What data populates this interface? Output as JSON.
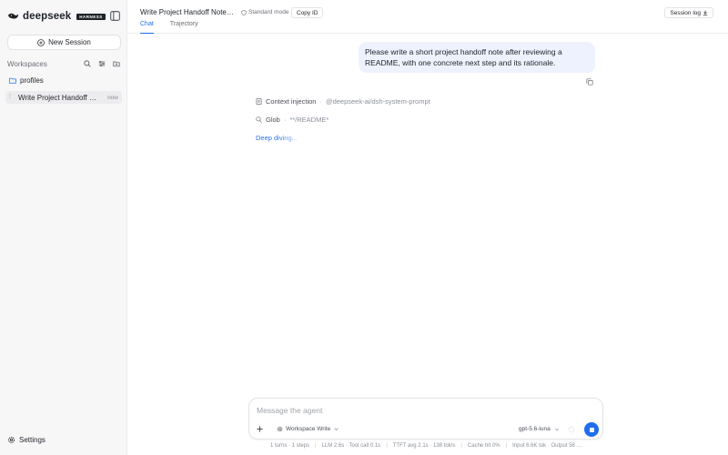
{
  "brand": {
    "name": "deepseek",
    "badge": "HARNESS"
  },
  "sidebar": {
    "new_session_label": "New Session",
    "workspaces_label": "Workspaces",
    "folder_label": "profiles",
    "session": {
      "title": "Write Project Handoff Note with",
      "time": "now",
      "status_glyph": "⁞"
    },
    "settings_label": "Settings"
  },
  "header": {
    "title": "Write Project Handoff Note with…",
    "mode_label": "Standard mode",
    "copy_id_label": "Copy ID",
    "session_log_label": "Session log",
    "tabs": [
      {
        "label": "Chat",
        "active": true
      },
      {
        "label": "Trajectory",
        "active": false
      }
    ]
  },
  "conversation": {
    "user_message": "Please write a short project handoff note after reviewing a README, with one concrete next step and its rationale.",
    "tool_calls": [
      {
        "name": "Context injection",
        "arg": "@deepseek-ai/dsh-system-prompt",
        "icon": "document-icon"
      },
      {
        "name": "Glob",
        "arg": "**/README*",
        "icon": "search-icon"
      }
    ],
    "status_text": "Deep diving..."
  },
  "composer": {
    "placeholder": "Message the agent",
    "permission_label": "Workspace Write",
    "model_label": "gpt-5.6-luna"
  },
  "stats": [
    "1 turns · 1 steps",
    "LLM 2.6s · Tool call 0.1s",
    "TTFT avg 2.1s · 138 tok/s",
    "Cache hit 0%",
    "Input 6.6K tok · Output 56 …"
  ],
  "colors": {
    "accent": "#1f6feb",
    "user_bubble": "#eef2fe",
    "sidebar_bg": "#f7f7f8"
  }
}
